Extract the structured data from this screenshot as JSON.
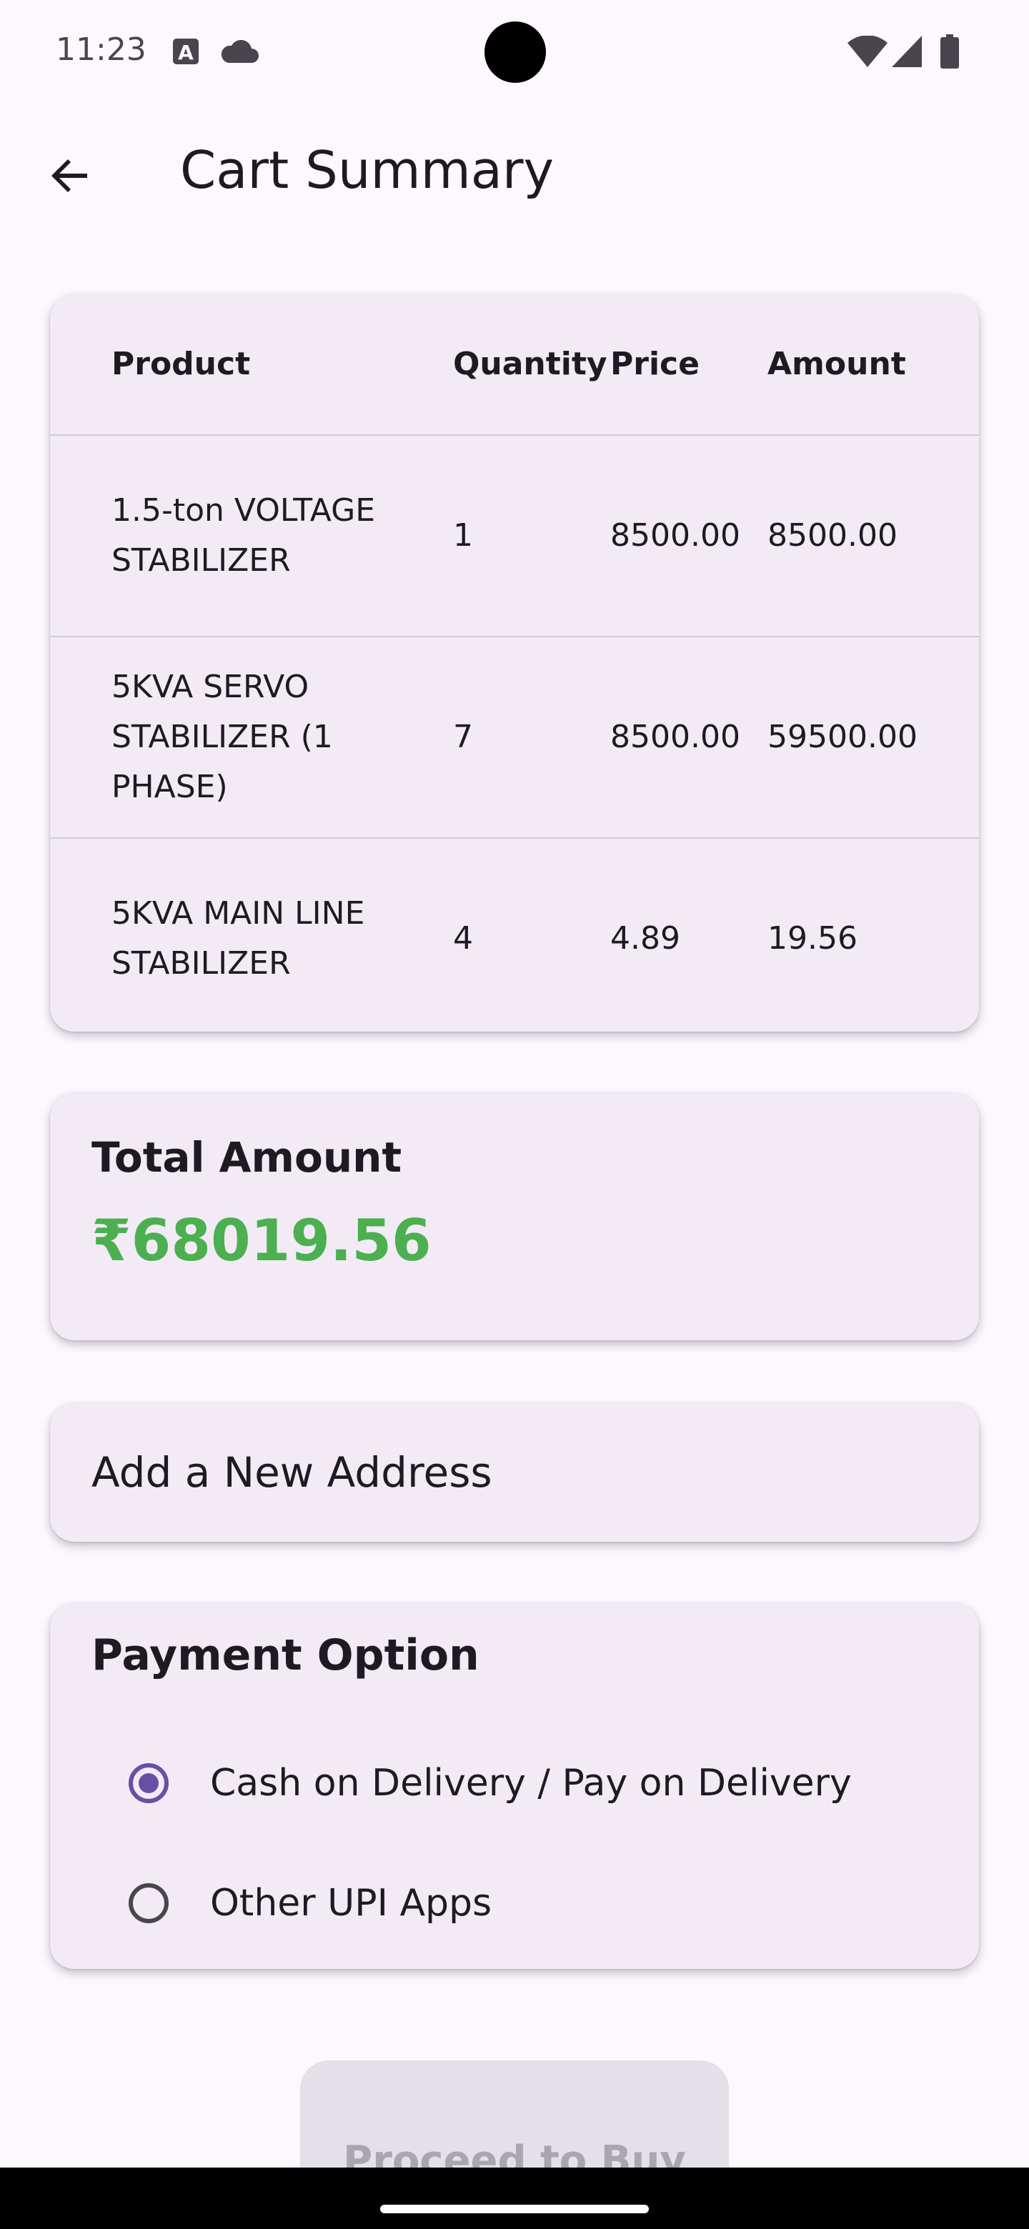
{
  "status_bar": {
    "time": "11:23",
    "icons": [
      "keyboard-a-icon",
      "cloud-icon",
      "wifi-icon",
      "cellular-signal-icon",
      "battery-icon"
    ]
  },
  "app_bar": {
    "back_icon": "arrow-back-icon",
    "title": "Cart Summary"
  },
  "cart_table": {
    "headers": {
      "product": "Product",
      "quantity": "Quantity",
      "price": "Price",
      "amount": "Amount"
    },
    "rows": [
      {
        "product": "1.5-ton VOLTAGE STABILIZER",
        "quantity": "1",
        "price": "8500.00",
        "amount": "8500.00"
      },
      {
        "product": "5KVA SERVO STABILIZER (1 PHASE)",
        "quantity": "7",
        "price": "8500.00",
        "amount": "59500.00"
      },
      {
        "product": "5KVA MAIN LINE STABILIZER",
        "quantity": "4",
        "price": "4.89",
        "amount": "19.56"
      }
    ]
  },
  "total": {
    "label": "Total Amount",
    "value": "₹68019.56",
    "value_color": "#4caf50"
  },
  "address": {
    "label": "Add a New Address"
  },
  "payment": {
    "title": "Payment Option",
    "options": [
      {
        "label": "Cash on Delivery / Pay on Delivery",
        "selected": true
      },
      {
        "label": "Other UPI Apps",
        "selected": false
      }
    ],
    "accent_color": "#6750a4"
  },
  "proceed_button": {
    "label": "Proceed to Buy",
    "state": "disabled"
  }
}
